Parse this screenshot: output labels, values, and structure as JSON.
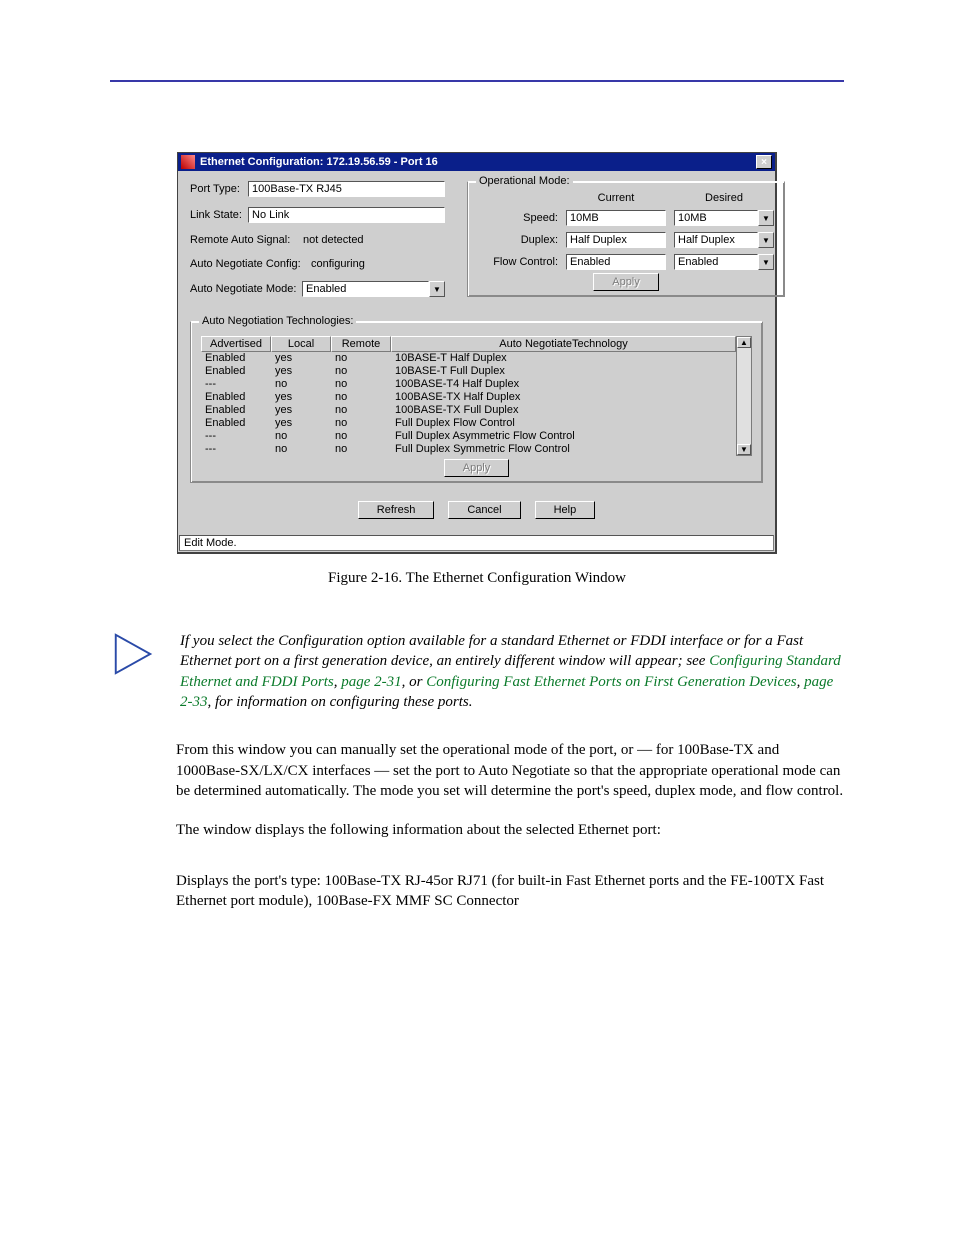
{
  "window": {
    "title": "Ethernet Configuration: 172.19.56.59 - Port 16",
    "close_label": "×",
    "status": "Edit Mode."
  },
  "left": {
    "port_type_label": "Port Type:",
    "port_type_value": "100Base-TX RJ45",
    "link_state_label": "Link State:",
    "link_state_value": "No Link",
    "remote_auto_label": "Remote Auto Signal:",
    "remote_auto_value": "not detected",
    "auto_neg_config_label": "Auto Negotiate Config:",
    "auto_neg_config_value": "configuring",
    "auto_neg_mode_label": "Auto Negotiate Mode:",
    "auto_neg_mode_value": "Enabled"
  },
  "op": {
    "group_title": "Operational Mode:",
    "current_hdr": "Current",
    "desired_hdr": "Desired",
    "speed_label": "Speed:",
    "speed_current": "10MB",
    "speed_desired": "10MB",
    "duplex_label": "Duplex:",
    "duplex_current": "Half Duplex",
    "duplex_desired": "Half Duplex",
    "flow_label": "Flow Control:",
    "flow_current": "Enabled",
    "flow_desired": "Enabled",
    "apply": "Apply"
  },
  "tech": {
    "group_title": "Auto Negotiation Technologies:",
    "cols": {
      "advertised": "Advertised",
      "local": "Local",
      "remote": "Remote",
      "tech": "Auto NegotiateTechnology"
    },
    "rows": [
      {
        "adv": "Enabled",
        "local": "yes",
        "remote": "no",
        "tech": "10BASE-T Half Duplex"
      },
      {
        "adv": "Enabled",
        "local": "yes",
        "remote": "no",
        "tech": "10BASE-T Full Duplex"
      },
      {
        "adv": "---",
        "local": "no",
        "remote": "no",
        "tech": "100BASE-T4 Half Duplex"
      },
      {
        "adv": "Enabled",
        "local": "yes",
        "remote": "no",
        "tech": "100BASE-TX Half Duplex"
      },
      {
        "adv": "Enabled",
        "local": "yes",
        "remote": "no",
        "tech": "100BASE-TX Full Duplex"
      },
      {
        "adv": "Enabled",
        "local": "yes",
        "remote": "no",
        "tech": "Full Duplex Flow Control"
      },
      {
        "adv": "---",
        "local": "no",
        "remote": "no",
        "tech": "Full Duplex Asymmetric Flow Control"
      },
      {
        "adv": "---",
        "local": "no",
        "remote": "no",
        "tech": "Full Duplex Symmetric Flow Control"
      }
    ],
    "apply": "Apply"
  },
  "buttons": {
    "refresh": "Refresh",
    "cancel": "Cancel",
    "help": "Help"
  },
  "caption": "Figure 2-16.  The Ethernet Configuration Window",
  "note": {
    "part1": "If you select the Configuration option available for a standard Ethernet or FDDI interface or for a Fast Ethernet port on a first generation device, an entirely different window will appear; see ",
    "link1": "Configuring Standard Ethernet and FDDI Ports",
    "sep1": ", ",
    "page1": "page 2-31",
    "mid": ", or ",
    "link2": "Configuring Fast Ethernet Ports on First Generation Devices",
    "sep2": ", ",
    "page2": "page 2-33",
    "tail": ", for information on configuring these ports."
  },
  "para1": "From this window you can manually set the operational mode of the port, or — for 100Base-TX and 1000Base-SX/LX/CX interfaces — set the port to Auto Negotiate so that the appropriate operational mode can be determined automatically. The mode you set will determine the port's speed, duplex mode, and flow control.",
  "para2": "The window displays the following information about the selected Ethernet port:",
  "para3": "Displays the port's type: 100Base-TX RJ-45or RJ71 (for built-in Fast Ethernet ports and the FE-100TX Fast Ethernet port module), 100Base-FX MMF SC Connector"
}
